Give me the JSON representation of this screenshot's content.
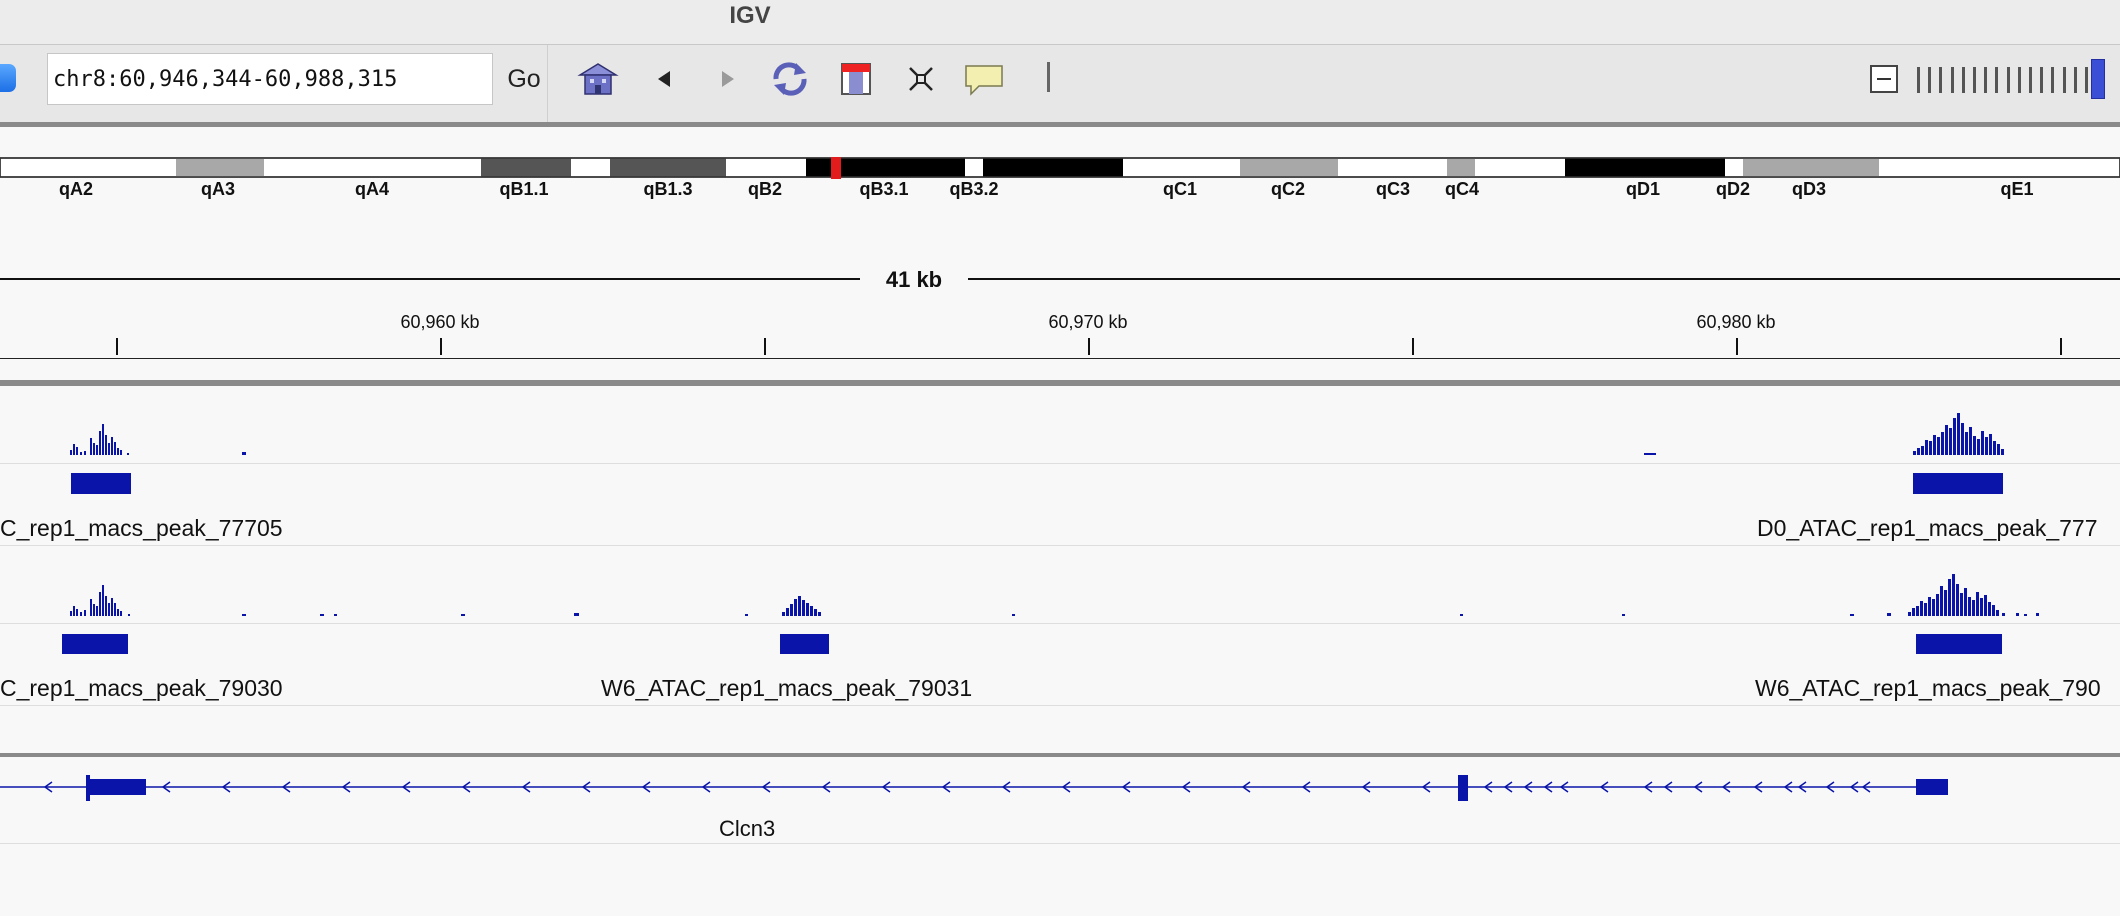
{
  "window": {
    "title": "IGV"
  },
  "toolbar": {
    "locus": "chr8:60,946,344-60,988,315",
    "go_label": "Go",
    "buttons": [
      {
        "name": "home-button",
        "icon": "home-icon"
      },
      {
        "name": "back-button",
        "icon": "arrow-left-icon"
      },
      {
        "name": "forward-button",
        "icon": "arrow-right-icon"
      },
      {
        "name": "refresh-button",
        "icon": "refresh-icon"
      },
      {
        "name": "roi-button",
        "icon": "region-of-interest-icon"
      },
      {
        "name": "resize-button",
        "icon": "fit-window-icon"
      },
      {
        "name": "popup-info-button",
        "icon": "speech-balloon-icon"
      }
    ],
    "zoom": {
      "level": "max"
    }
  },
  "ideogram": {
    "bands": [
      "qA2",
      "qA3",
      "qA4",
      "qB1.1",
      "qB1.3",
      "qB2",
      "qB3.1",
      "qB3.2",
      "qC1",
      "qC2",
      "qC3",
      "qC4",
      "qD1",
      "qD2",
      "qD3",
      "qE1"
    ]
  },
  "ruler": {
    "span_label": "41 kb",
    "ticks": [
      "60,960 kb",
      "60,970 kb",
      "60,980 kb"
    ]
  },
  "tracks": {
    "d0_peaks": [
      "C_rep1_macs_peak_77705",
      "D0_ATAC_rep1_macs_peak_777"
    ],
    "w6_peaks": [
      "C_rep1_macs_peak_79030",
      "W6_ATAC_rep1_macs_peak_79031",
      "W6_ATAC_rep1_macs_peak_790"
    ],
    "gene": "Clcn3"
  },
  "colors": {
    "signal": "#0a14a8",
    "ideogram_dark": "#000000",
    "ideogram_mid": "#555555",
    "ideogram_light": "#a8a8a8",
    "current_region": "#e21c1c"
  }
}
